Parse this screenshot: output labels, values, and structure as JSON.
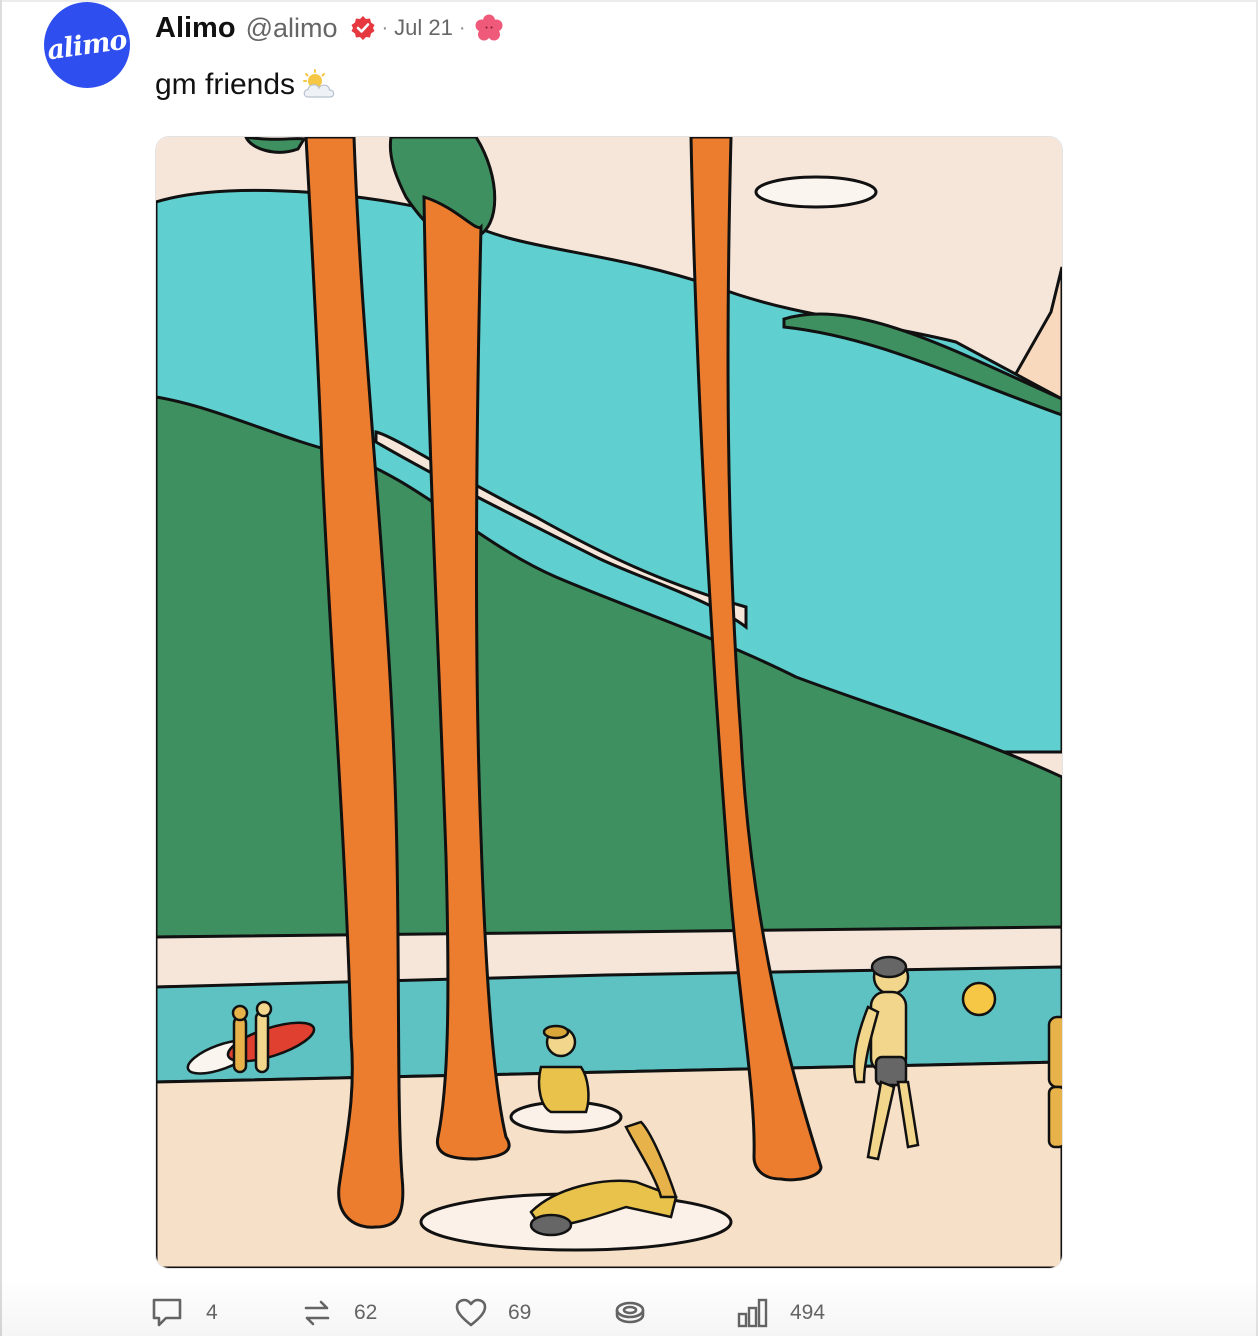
{
  "post": {
    "avatar_icon": "alimo-logo-icon",
    "avatar_text": "alimo",
    "display_name": "Alimo",
    "handle": "@alimo",
    "verified_icon": "verified-badge-icon",
    "separator": "·",
    "date": "Jul 21",
    "channel_icon": "flower-icon",
    "text": "gm friends",
    "text_emoji": "sun-behind-cloud-icon"
  },
  "colors": {
    "avatar_bg": "#2f4ef0",
    "verified": "#e5393f",
    "flower": "#ef5a7a",
    "sky": "#f6e6da",
    "turquoise": "#5fcfcf",
    "green": "#3f9060",
    "trunk": "#ec7c2e"
  },
  "actions": [
    {
      "name": "reply",
      "icon": "comment-icon",
      "count": "4"
    },
    {
      "name": "recast",
      "icon": "recast-icon",
      "count": "62"
    },
    {
      "name": "like",
      "icon": "heart-icon",
      "count": "69"
    },
    {
      "name": "tip",
      "icon": "coin-stack-icon",
      "count": ""
    },
    {
      "name": "views",
      "icon": "bar-chart-icon",
      "count": "494"
    }
  ]
}
